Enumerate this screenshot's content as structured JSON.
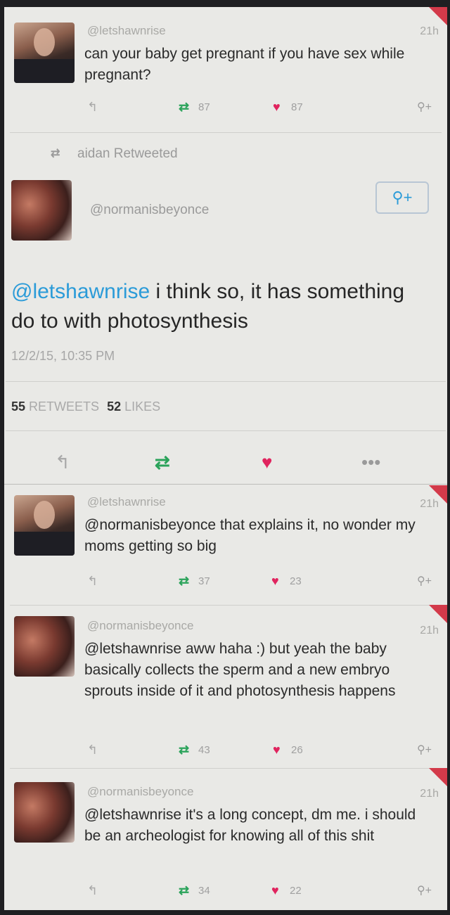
{
  "tweet1": {
    "handle": "@letshawnrise",
    "time": "21h",
    "text": "can your baby get pregnant if you have sex while pregnant?",
    "retweets": "87",
    "likes": "87"
  },
  "retweet_banner": "aidan Retweeted",
  "main_tweet": {
    "handle": "@normanisbeyonce",
    "mention": "@letshawnrise",
    "text": " i think so, it has something do to with photosynthesis",
    "date": "12/2/15, 10:35 PM",
    "retweets_count": "55",
    "retweets_label": "RETWEETS",
    "likes_count": "52",
    "likes_label": "LIKES"
  },
  "tweet3": {
    "handle": "@letshawnrise",
    "time": "21h",
    "text": "@normanisbeyonce that explains it, no wonder my moms getting so big",
    "retweets": "37",
    "likes": "23"
  },
  "tweet4": {
    "handle": "@normanisbeyonce",
    "time": "21h",
    "text": "@letshawnrise aww haha :) but yeah the baby basically collects the sperm and a new embryo sprouts inside of it and photosynthesis happens",
    "retweets": "43",
    "likes": "26"
  },
  "tweet5": {
    "handle": "@normanisbeyonce",
    "time": "21h",
    "text": "@letshawnrise it's a long concept, dm me. i should be an archeologist for knowing all of this shit",
    "retweets": "34",
    "likes": "22"
  },
  "icons": {
    "reply": "reply-icon",
    "retweet": "retweet-icon",
    "like": "heart-icon",
    "follow": "add-user-icon",
    "more": "more-icon"
  },
  "colors": {
    "heart": "#e0245e",
    "retweet": "#2aa35a",
    "link": "#2b9bd8"
  }
}
